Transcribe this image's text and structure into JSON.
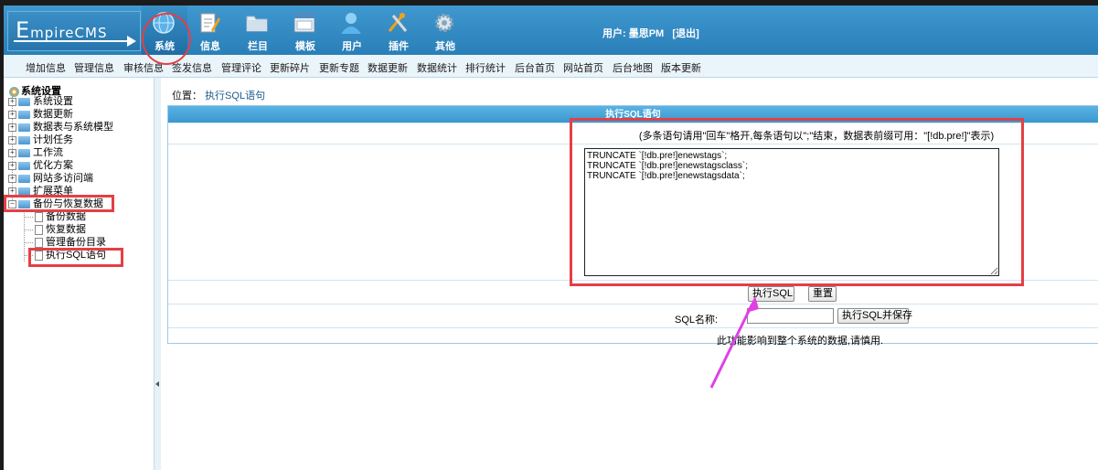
{
  "app": {
    "logo": {
      "prefix": "E",
      "rest": "mpireCMS"
    },
    "user_label": "用户: 墨思PM",
    "logout": "[退出]"
  },
  "top_nav": [
    {
      "label": "系统",
      "icon": "globe-icon",
      "color": "#5ab3ea",
      "active": true
    },
    {
      "label": "信息",
      "icon": "edit-icon",
      "color": "#f0a21e"
    },
    {
      "label": "栏目",
      "icon": "folder-icon",
      "color": "#e6eef6"
    },
    {
      "label": "模板",
      "icon": "window-icon",
      "color": "#e6eef6"
    },
    {
      "label": "用户",
      "icon": "user-icon",
      "color": "#5ab3ea"
    },
    {
      "label": "插件",
      "icon": "tools-icon",
      "color": "#f0a21e"
    },
    {
      "label": "其他",
      "icon": "gear-icon",
      "color": "#d8e6f2"
    }
  ],
  "sub_nav": [
    "增加信息",
    "管理信息",
    "审核信息",
    "签发信息",
    "管理评论",
    "更新碎片",
    "更新专题",
    "数据更新",
    "数据统计",
    "排行统计",
    "后台首页",
    "网站首页",
    "后台地图",
    "版本更新"
  ],
  "sidebar": {
    "root": "系统设置",
    "folders": [
      "系统设置",
      "数据更新",
      "数据表与系统模型",
      "计划任务",
      "工作流",
      "优化方案",
      "网站多访问端",
      "扩展菜单",
      "备份与恢复数据"
    ],
    "children": [
      "备份数据",
      "恢复数据",
      "管理备份目录",
      "执行SQL语句"
    ]
  },
  "main": {
    "breadcrumb_prefix": "位置：",
    "breadcrumb_link": "执行SQL语句",
    "panel_title": "执行SQL语句",
    "hint": "(多条语句请用\"回车\"格开,每条语句以\";\"结束，数据表前缀可用：\"[!db.pre!]\"表示)",
    "sql": "TRUNCATE `[!db.pre!]enewstags`;\nTRUNCATE `[!db.pre!]enewstagsclass`;\nTRUNCATE `[!db.pre!]enewstagsdata`;",
    "execute_button": "执行SQL",
    "reset_button": "重置",
    "sql_name_label": "SQL名称:",
    "sql_name_value": "",
    "execute_save_button": "执行SQL并保存",
    "warning": "此功能影响到整个系统的数据,请慎用."
  },
  "colors": {
    "header_blue": "#2a7fb8",
    "annotation_red": "#e53f44",
    "annotation_arrow": "#e040e6"
  }
}
